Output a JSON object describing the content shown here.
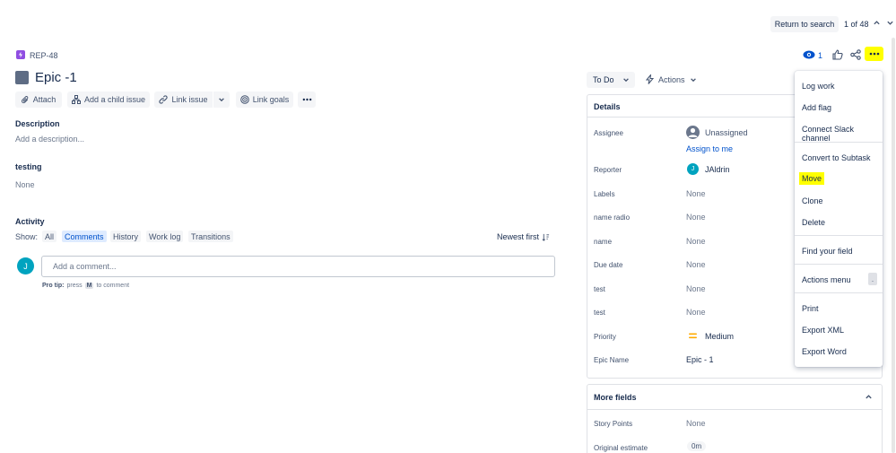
{
  "topnav": {
    "return_label": "Return to search",
    "pager": "1 of 48"
  },
  "issue": {
    "key": "REP-48",
    "title": "Epic -1",
    "watchers": "1"
  },
  "toolbar": {
    "attach": "Attach",
    "add_child": "Add a child issue",
    "link_issue": "Link issue",
    "link_goals": "Link goals"
  },
  "description": {
    "heading": "Description",
    "placeholder": "Add a description..."
  },
  "testing": {
    "heading": "testing",
    "value": "None"
  },
  "activity": {
    "heading": "Activity",
    "show": "Show:",
    "filters": [
      "All",
      "Comments",
      "History",
      "Work log",
      "Transitions"
    ],
    "sort": "Newest first",
    "comment_placeholder": "Add a comment...",
    "avatar_initial": "J",
    "tip_prefix": "Pro tip:",
    "tip_press": "press",
    "tip_key": "M",
    "tip_suffix": "to comment"
  },
  "status": {
    "label": "To Do",
    "actions": "Actions"
  },
  "details": {
    "heading": "Details",
    "fields": [
      {
        "label": "Assignee",
        "value": "Unassigned",
        "link": "Assign to me"
      },
      {
        "label": "Reporter",
        "value": "JAldrin",
        "initial": "J"
      },
      {
        "label": "Labels",
        "value": "None"
      },
      {
        "label": "name radio",
        "value": "None"
      },
      {
        "label": "name",
        "value": "None"
      },
      {
        "label": "Due date",
        "value": "None"
      },
      {
        "label": "test",
        "value": "None"
      },
      {
        "label": "test",
        "value": "None"
      },
      {
        "label": "Priority",
        "value": "Medium"
      },
      {
        "label": "Epic Name",
        "value": "Epic - 1"
      }
    ]
  },
  "more_fields": {
    "heading": "More fields",
    "fields": [
      {
        "label": "Story Points",
        "value": "None"
      },
      {
        "label": "Original estimate",
        "value": "0m"
      }
    ]
  },
  "dropdown": {
    "items": [
      "Log work",
      "Add flag",
      "Connect Slack channel",
      "Convert to Subtask",
      "Move",
      "Clone",
      "Delete",
      "Find your field",
      "Actions menu",
      "Print",
      "Export XML",
      "Export Word"
    ],
    "shortcut": "."
  },
  "colors": {
    "highlight": "#ffff00",
    "link": "#0052cc",
    "epic": "#6554c0",
    "priority": "#ffab00",
    "avatar": "#00a3bf"
  }
}
